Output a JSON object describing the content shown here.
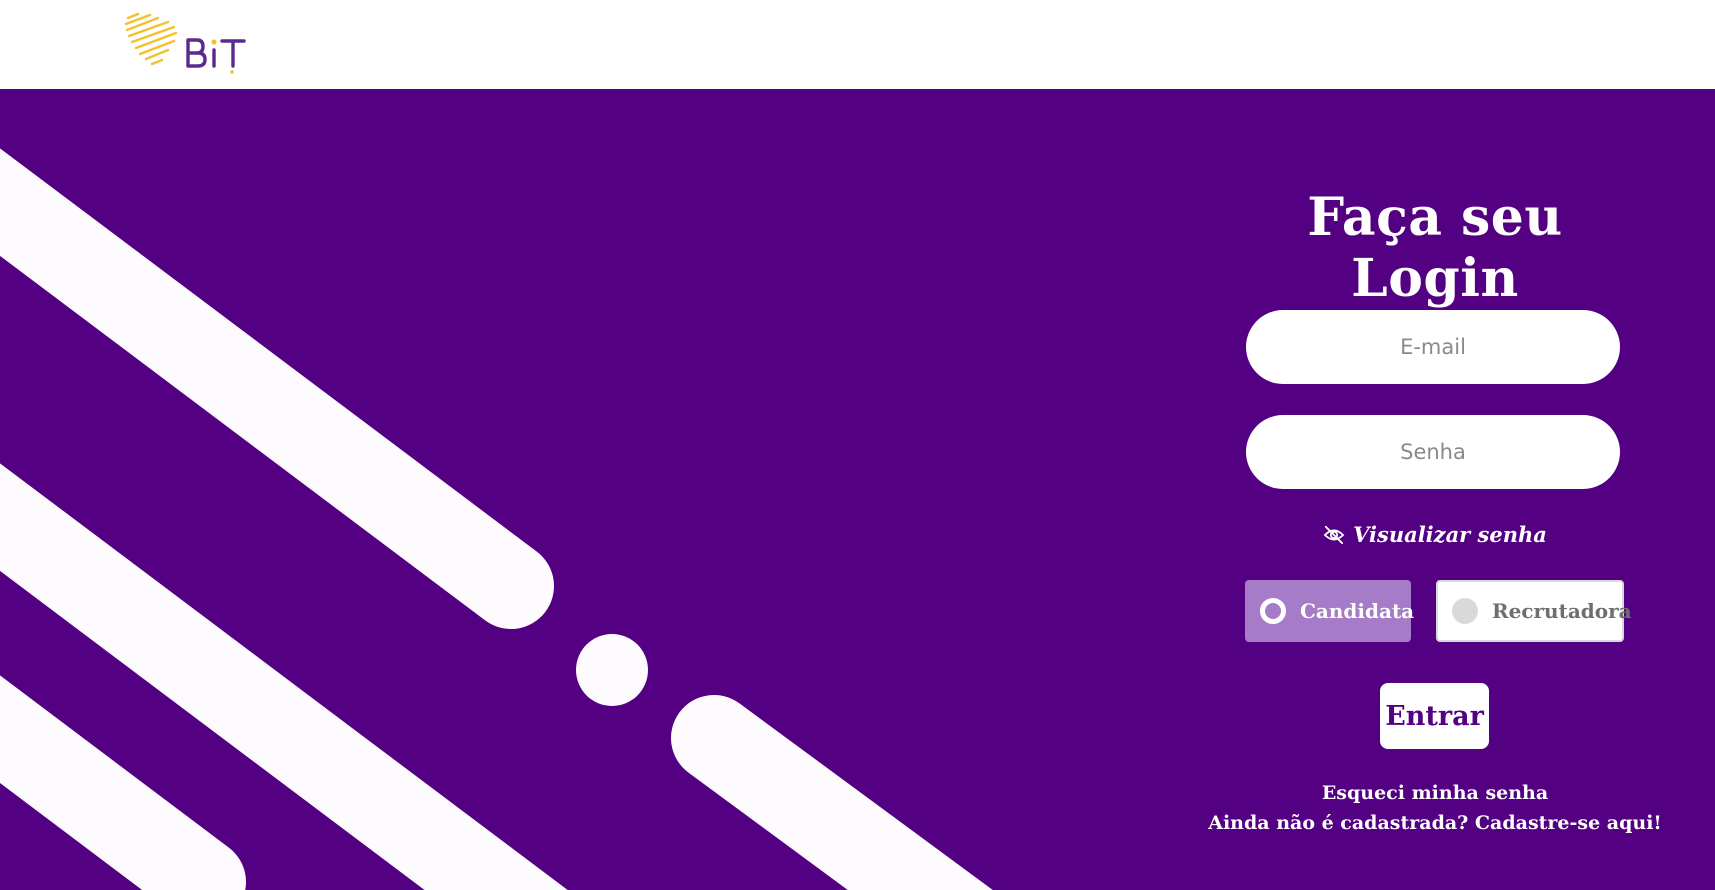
{
  "header": {
    "logo_text": "BIT",
    "logo_colors": {
      "map": "#f2c12e",
      "text": "#5b2a8e"
    }
  },
  "hero": {
    "background": "#530082",
    "stripe_color": "#fdfbfd"
  },
  "login": {
    "title": "Faça seu Login",
    "email_placeholder": "E-mail",
    "password_placeholder": "Senha",
    "show_password_label": "Visualizar senha",
    "show_password_icon": "eye-slash-icon",
    "roles": [
      {
        "label": "Candidata",
        "selected": true
      },
      {
        "label": "Recrutadora",
        "selected": false
      }
    ],
    "submit_label": "Entrar",
    "forgot_password": "Esqueci minha senha",
    "signup": "Ainda não é cadastrada? Cadastre-se aqui!"
  }
}
